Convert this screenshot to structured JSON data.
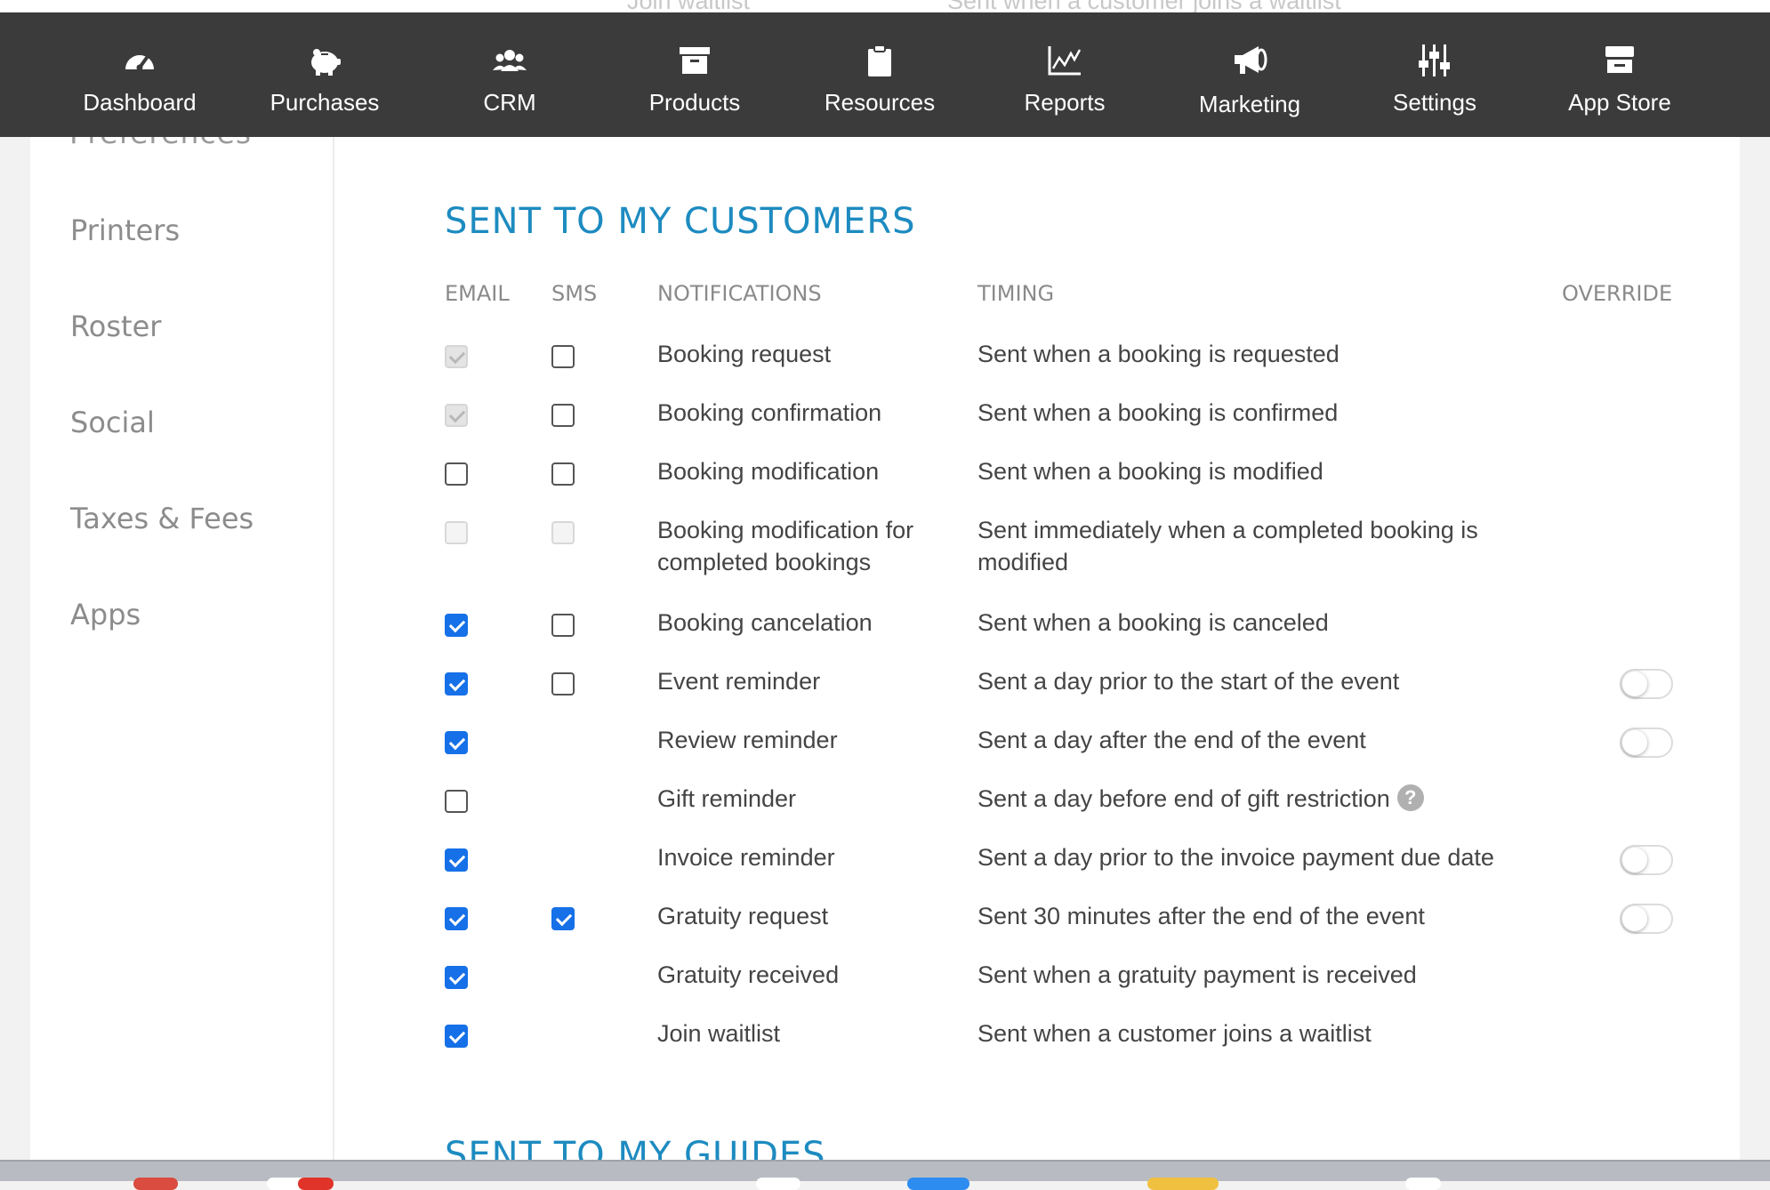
{
  "top_strip": {
    "left_text": "Join waitlist",
    "right_text": "Sent when a customer joins a waitlist"
  },
  "nav": [
    {
      "label": "Dashboard",
      "icon": "gauge-icon"
    },
    {
      "label": "Purchases",
      "icon": "piggy-bank-icon"
    },
    {
      "label": "CRM",
      "icon": "users-icon"
    },
    {
      "label": "Products",
      "icon": "box-icon"
    },
    {
      "label": "Resources",
      "icon": "clipboard-icon"
    },
    {
      "label": "Reports",
      "icon": "line-chart-icon"
    },
    {
      "label": "Marketing",
      "icon": "megaphone-icon"
    },
    {
      "label": "Settings",
      "icon": "sliders-icon"
    },
    {
      "label": "App Store",
      "icon": "store-icon"
    }
  ],
  "sidebar": {
    "cut_item": "Preferences",
    "items": [
      "Printers",
      "Roster",
      "Social",
      "Taxes & Fees",
      "Apps"
    ]
  },
  "section": {
    "title": "SENT TO MY CUSTOMERS",
    "next_title": "SENT TO MY GUIDES",
    "headers": {
      "email": "EMAIL",
      "sms": "SMS",
      "notifications": "NOTIFICATIONS",
      "timing": "TIMING",
      "override": "OVERRIDE"
    }
  },
  "rows": [
    {
      "email": "disabled-checked",
      "sms": "unchecked",
      "notification": "Booking request",
      "timing": "Sent when a booking is requested",
      "override": false,
      "help": false
    },
    {
      "email": "disabled-checked",
      "sms": "unchecked",
      "notification": "Booking confirmation",
      "timing": "Sent when a booking is confirmed",
      "override": false,
      "help": false
    },
    {
      "email": "unchecked",
      "sms": "unchecked",
      "notification": "Booking modification",
      "timing": "Sent when a booking is modified",
      "override": false,
      "help": false
    },
    {
      "email": "disabled",
      "sms": "disabled",
      "notification": "Booking modification for completed bookings",
      "timing": "Sent immediately when a completed booking is modified",
      "override": false,
      "help": false
    },
    {
      "email": "checked",
      "sms": "unchecked",
      "notification": "Booking cancelation",
      "timing": "Sent when a booking is canceled",
      "override": false,
      "help": false
    },
    {
      "email": "checked",
      "sms": "unchecked",
      "notification": "Event reminder",
      "timing": "Sent a day prior to the start of the event",
      "override": true,
      "help": false
    },
    {
      "email": "checked",
      "sms": "none",
      "notification": "Review reminder",
      "timing": "Sent a day after the end of the event",
      "override": true,
      "help": false
    },
    {
      "email": "unchecked",
      "sms": "none",
      "notification": "Gift reminder",
      "timing": "Sent a day before end of gift restriction",
      "override": false,
      "help": true
    },
    {
      "email": "checked",
      "sms": "none",
      "notification": "Invoice reminder",
      "timing": "Sent a day prior to the invoice payment due date",
      "override": true,
      "help": false
    },
    {
      "email": "checked",
      "sms": "checked",
      "notification": "Gratuity request",
      "timing": "Sent 30 minutes after the end of the event",
      "override": true,
      "help": false
    },
    {
      "email": "checked",
      "sms": "none",
      "notification": "Gratuity received",
      "timing": "Sent when a gratuity payment is received",
      "override": false,
      "help": false
    },
    {
      "email": "checked",
      "sms": "none",
      "notification": "Join waitlist",
      "timing": "Sent when a customer joins a waitlist",
      "override": false,
      "help": false
    }
  ],
  "help_glyph": "?",
  "colors": {
    "accent": "#1d8bc0",
    "checkbox": "#1670e8",
    "navbar": "#3b3b3b"
  }
}
